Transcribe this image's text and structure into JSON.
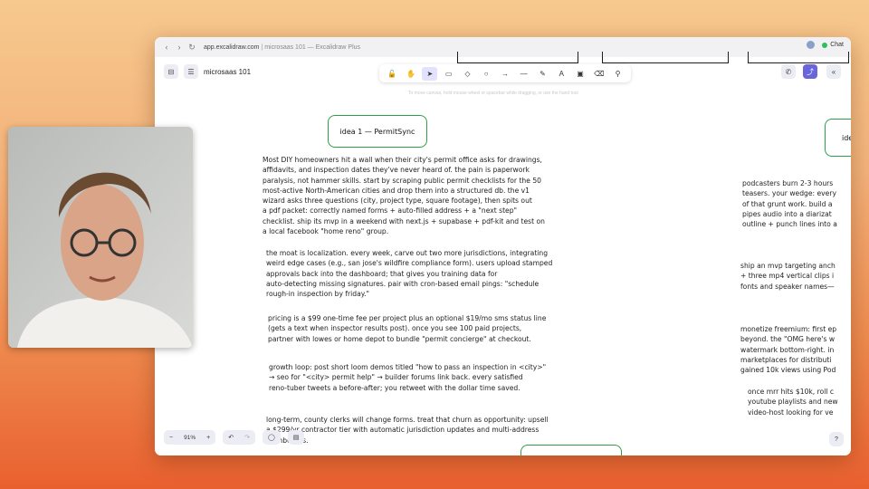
{
  "browser": {
    "url_domain": "app.excalidraw.com",
    "url_separator": " | ",
    "url_path": "microsaas 101 — Excalidraw Plus",
    "chat_label": "Chat"
  },
  "app": {
    "file_name": "microsaas 101",
    "hint": "To move canvas, hold mouse wheel or spacebar while dragging, or use the hand tool",
    "zoom": "91%"
  },
  "toolbar": {
    "tools": [
      {
        "name": "lock",
        "glyph": "🔓"
      },
      {
        "name": "hand",
        "glyph": "✋"
      },
      {
        "name": "selection",
        "glyph": "➤",
        "active": true
      },
      {
        "name": "rectangle",
        "glyph": "▭"
      },
      {
        "name": "diamond",
        "glyph": "◇"
      },
      {
        "name": "ellipse",
        "glyph": "○"
      },
      {
        "name": "arrow",
        "glyph": "→"
      },
      {
        "name": "line",
        "glyph": "—"
      },
      {
        "name": "draw",
        "glyph": "✎"
      },
      {
        "name": "text",
        "glyph": "A"
      },
      {
        "name": "image",
        "glyph": "▣"
      },
      {
        "name": "eraser",
        "glyph": "⌫"
      },
      {
        "name": "more-tools",
        "glyph": "⚲"
      }
    ]
  },
  "canvas": {
    "idea_title": "idea 1 — PermitSync",
    "idea2_title_partial": "ide",
    "notes": [
      "Most DIY homeowners hit a wall when their city's permit office asks for drawings,\naffidavits, and inspection dates they've never heard of. the pain is paperwork\nparalysis, not hammer skills. start by scraping public permit checklists for the 50\nmost-active North-American cities and drop them into a structured db. the v1\nwizard asks three questions (city, project type, square footage), then spits out\na pdf packet: correctly named forms + auto-filled address + a \"next step\"\nchecklist. ship its mvp in a weekend with next.js + supabase + pdf-kit and test on\na local facebook \"home reno\" group.",
      "the moat is localization. every week, carve out two more jurisdictions, integrating\nweird edge cases (e.g., san jose's wildfire compliance form). users upload stamped\napprovals back into the dashboard; that gives you training data for\nauto-detecting missing signatures. pair with cron-based email pings: \"schedule\nrough-in inspection by friday.\"",
      "pricing is a $99 one-time fee per project plus an optional $19/mo sms status line\n(gets a text when inspector results post). once you see 100 paid projects,\npartner with lowes or home depot to bundle \"permit concierge\" at checkout.",
      "growth loop: post short loom demos titled \"how to pass an inspection in <city>\"\n→ seo for \"<city> permit help\" → builder forums link back. every satisfied\nreno-tuber tweets a before-after; you retweet with the dollar time saved.",
      "long-term, county clerks will change forms. treat that churn as opportunity: upsell\na $299/yr contractor tier with automatic jurisdiction updates and multi-address\ndashboards."
    ],
    "right_notes": [
      "podcasters burn 2-3 hours\nteasers. your wedge: every\nof that grunt work. build a\npipes audio into a diarizat\noutline + punch lines into a",
      "ship an mvp targeting anch\n+ three mp4 vertical clips i\nfonts and speaker names—",
      "monetize freemium: first ep\nbeyond. the \"OMG here's w\nwatermark bottom-right. in\nmarketplaces for distributi\ngained 10k views using Pod",
      "once mrr hits $10k, roll c\nyoutube playlists and new\nvideo-host looking for ve"
    ]
  },
  "colors": {
    "accent": "#6965db",
    "title_border": "#2f9e44",
    "ink": "#1e1e1e"
  }
}
